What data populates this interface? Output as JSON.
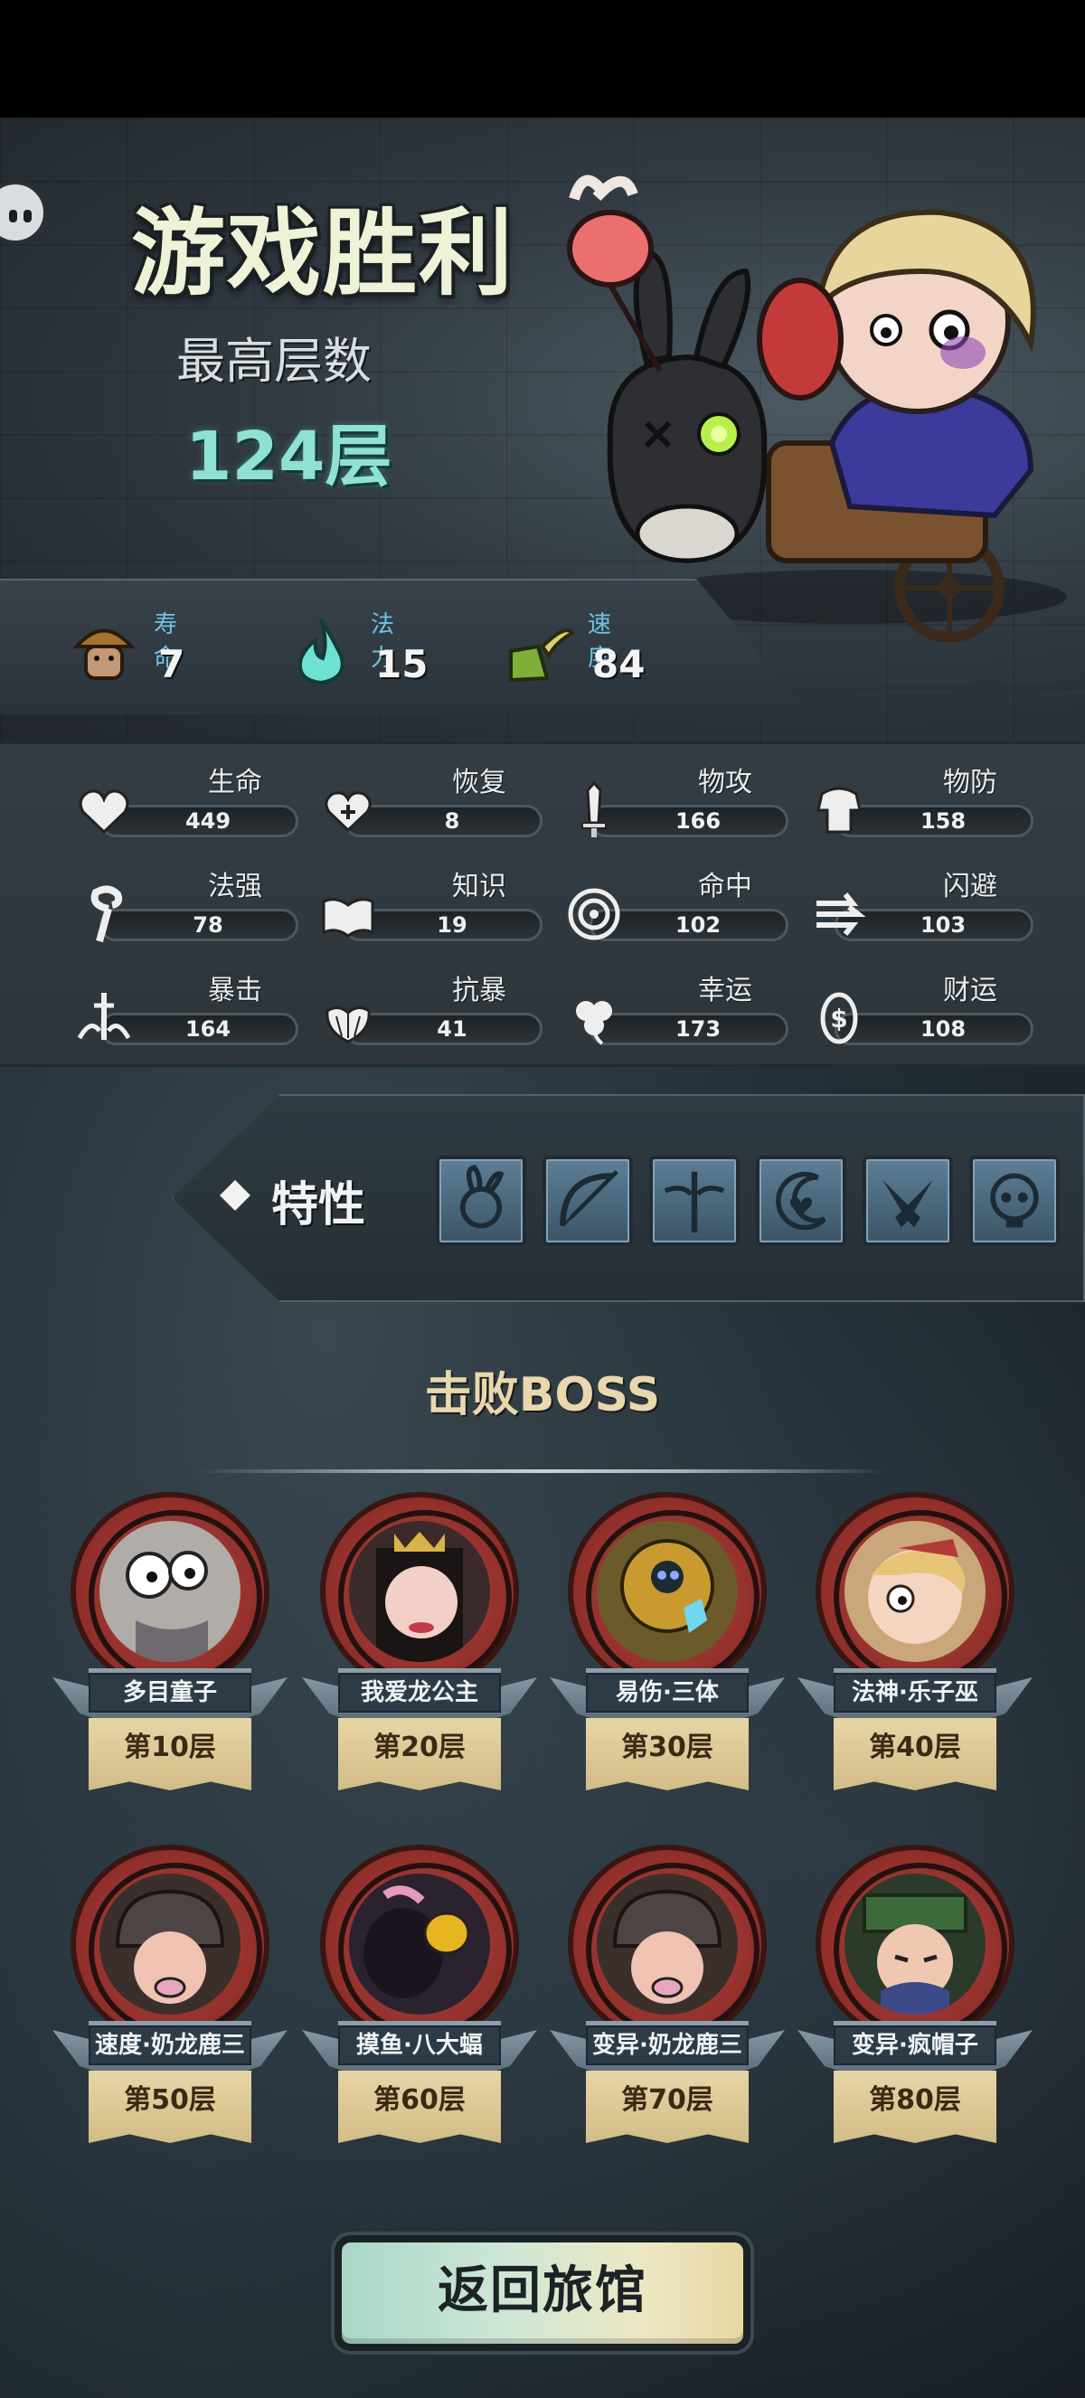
{
  "result": {
    "title": "游戏胜利",
    "floor_label": "最高层数",
    "floor_value": "124层"
  },
  "basic_stats": [
    {
      "label": "寿命",
      "value": "7",
      "icon": "mushroom-character-icon"
    },
    {
      "label": "法力",
      "value": "15",
      "icon": "cyan-flame-icon"
    },
    {
      "label": "速度",
      "value": "84",
      "icon": "winged-boot-icon"
    }
  ],
  "attributes": [
    {
      "name": "生命",
      "value": "449",
      "icon": "heart-icon"
    },
    {
      "name": "恢复",
      "value": "8",
      "icon": "heal-heart-icon"
    },
    {
      "name": "物攻",
      "value": "166",
      "icon": "sword-icon"
    },
    {
      "name": "物防",
      "value": "158",
      "icon": "armor-icon"
    },
    {
      "name": "法强",
      "value": "78",
      "icon": "staff-icon"
    },
    {
      "name": "知识",
      "value": "19",
      "icon": "book-icon"
    },
    {
      "name": "命中",
      "value": "102",
      "icon": "target-icon"
    },
    {
      "name": "闪避",
      "value": "103",
      "icon": "dodge-arrows-icon"
    },
    {
      "name": "暴击",
      "value": "164",
      "icon": "crit-blade-icon"
    },
    {
      "name": "抗暴",
      "value": "41",
      "icon": "shell-shield-icon"
    },
    {
      "name": "幸运",
      "value": "173",
      "icon": "clover-icon"
    },
    {
      "name": "财运",
      "value": "108",
      "icon": "coin-icon"
    }
  ],
  "traits": {
    "label": "特性",
    "items": [
      {
        "icon": "rabbit-trait-icon"
      },
      {
        "icon": "bow-trait-icon"
      },
      {
        "icon": "winged-sword-trait-icon"
      },
      {
        "icon": "moon-heart-trait-icon"
      },
      {
        "icon": "crossed-guns-trait-icon"
      },
      {
        "icon": "skull-trait-icon"
      }
    ]
  },
  "bosses": {
    "title": "击败BOSS",
    "items": [
      {
        "name": "多目童子",
        "floor": "第10层"
      },
      {
        "name": "我爱龙公主",
        "floor": "第20层"
      },
      {
        "name": "易伤·三体",
        "floor": "第30层"
      },
      {
        "name": "法神·乐子巫",
        "floor": "第40层"
      },
      {
        "name": "速度·奶龙鹿三",
        "floor": "第50层"
      },
      {
        "name": "摸鱼·八大蝠",
        "floor": "第60层"
      },
      {
        "name": "变异·奶龙鹿三",
        "floor": "第70层"
      },
      {
        "name": "变异·疯帽子",
        "floor": "第80层"
      }
    ]
  },
  "return_button": "返回旅馆",
  "colors": {
    "floor_value": "#8fe2d3",
    "stat_label": "#6fc3e6",
    "boss_frame": "#8f2e2a",
    "boss_scroll": "#e8d5a6",
    "button_gradient_start": "#a9d7c8",
    "button_gradient_end": "#e6d8a3"
  }
}
